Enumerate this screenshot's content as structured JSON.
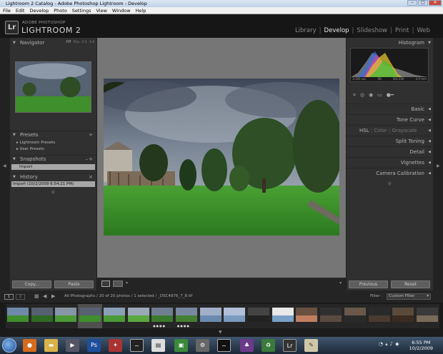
{
  "window": {
    "title": "Lightroom 2 Catalog - Adobe Photoshop Lightroom - Develop"
  },
  "menu": [
    "File",
    "Edit",
    "Develop",
    "Photo",
    "Settings",
    "View",
    "Window",
    "Help"
  ],
  "identity": {
    "logo": "Lr",
    "adobe_line": "ADOBE PHOTOSHOP",
    "product": "LIGHTROOM 2"
  },
  "modules": [
    "Library",
    "Develop",
    "Slideshow",
    "Print",
    "Web"
  ],
  "active_module": "Develop",
  "left_panel": {
    "navigator": {
      "title": "Navigator",
      "modes": [
        "FIT",
        "FILL",
        "1:1",
        "1:4"
      ]
    },
    "presets": {
      "title": "Presets",
      "items": [
        "Lightroom Presets",
        "User Presets"
      ]
    },
    "snapshots": {
      "title": "Snapshots",
      "items": [
        "Import"
      ]
    },
    "history": {
      "title": "History",
      "items": [
        "Import (10/2/2009 6:54:21 PM)"
      ]
    },
    "copy_label": "Copy...",
    "paste_label": "Paste"
  },
  "right_panel": {
    "histogram": {
      "title": "Histogram",
      "info": [
        "1/160 sec",
        "f/8",
        "ISO 200",
        "4.9 mm"
      ]
    },
    "sections": [
      "Basic",
      "Tone Curve",
      "Split Toning",
      "Detail",
      "Vignettes",
      "Camera Calibration"
    ],
    "hsl_tabs": [
      "HSL",
      "Color",
      "Grayscale"
    ],
    "previous_label": "Previous",
    "reset_label": "Reset"
  },
  "filmstrip": {
    "pages": [
      "1",
      "2"
    ],
    "source": "All Photographs / 20 of 20 photos / 1 selected / _DSC4976_7_8.tif",
    "filter_label": "Filter :",
    "filter_value": "Custom Filter",
    "thumb_count": 18,
    "selected_index": 3,
    "starred_indices": [
      6,
      7
    ]
  },
  "taskbar": {
    "time": "6:55 PM",
    "date": "10/2/2009"
  },
  "colors": {
    "panel_bg": "#303030",
    "center_bg": "#767676",
    "active_module": "#e8e8e8",
    "selected_row": "#a7a7a7"
  }
}
